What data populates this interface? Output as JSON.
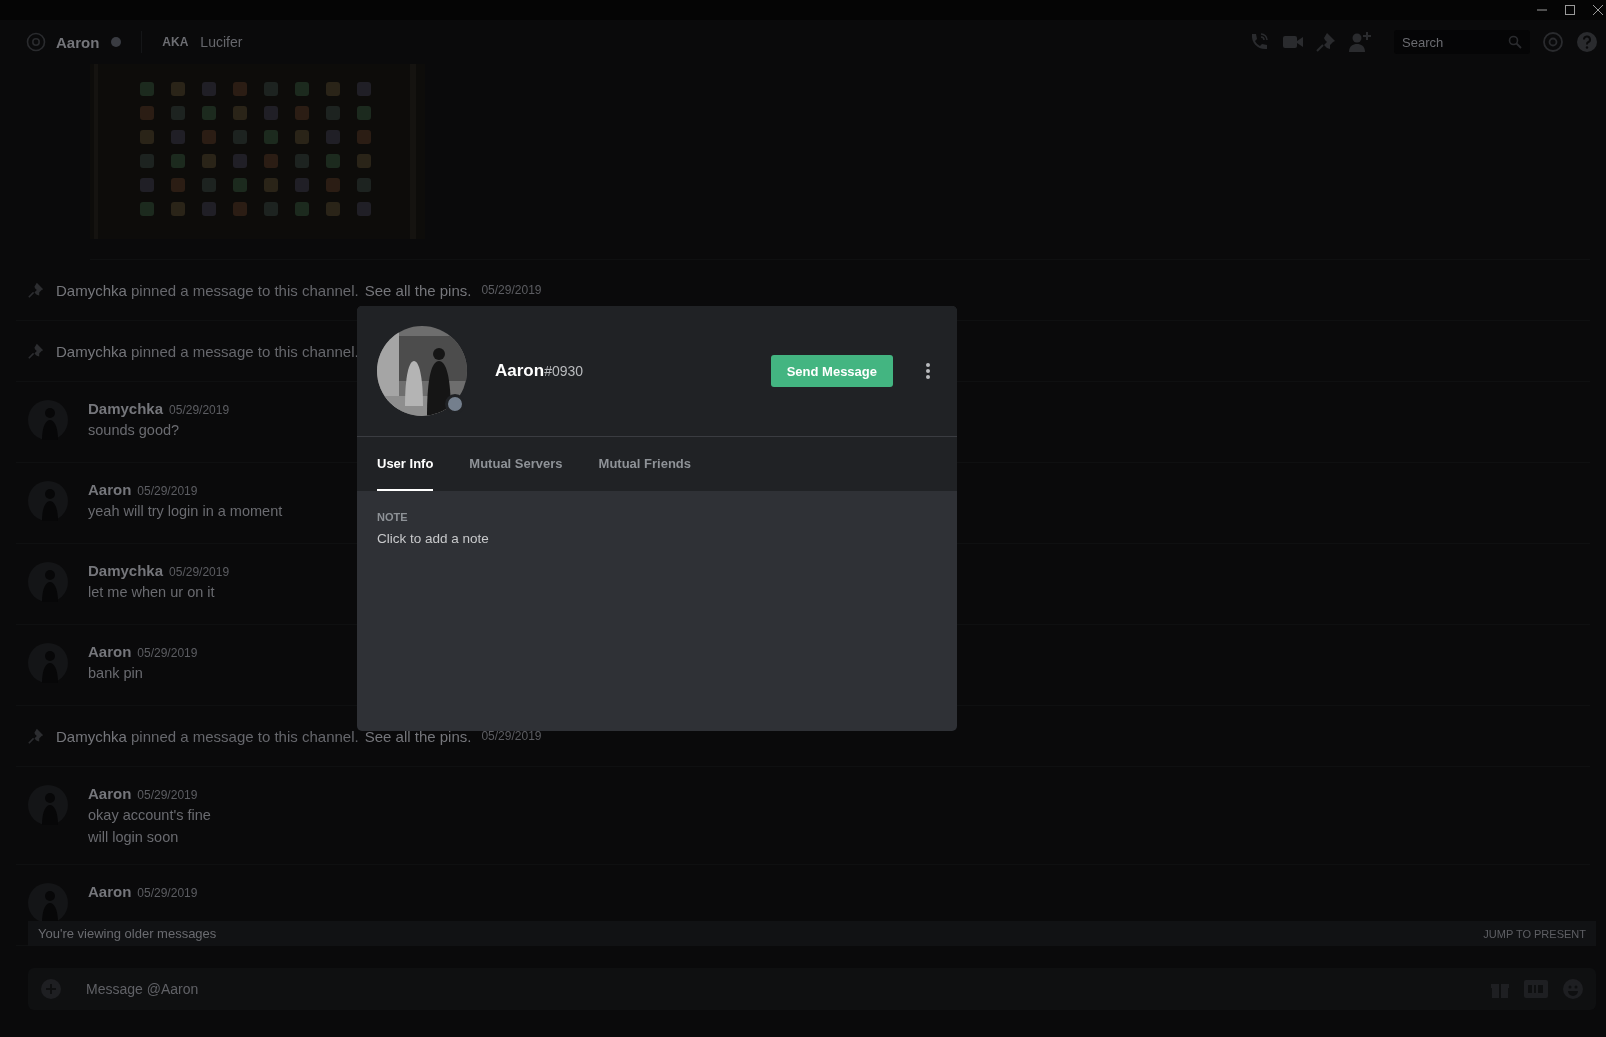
{
  "header": {
    "name": "Aaron",
    "online": false,
    "aka_label": "AKA",
    "aka": "Lucifer",
    "search": {
      "placeholder": "Search"
    }
  },
  "messages": [
    {
      "kind": "attachment"
    },
    {
      "kind": "pin",
      "author": "Damychka",
      "text": "pinned a message to this channel.",
      "link": "See all the pins.",
      "time": "05/29/2019"
    },
    {
      "kind": "pin",
      "author": "Damychka",
      "text": "pinned a message to this channel."
    },
    {
      "kind": "message",
      "author": "Damychka",
      "time": "05/29/2019",
      "lines": [
        "sounds good?"
      ]
    },
    {
      "kind": "message",
      "author": "Aaron",
      "time": "05/29/2019",
      "lines": [
        "yeah will try login in a moment"
      ]
    },
    {
      "kind": "message",
      "author": "Damychka",
      "time": "05/29/2019",
      "lines": [
        "let me when ur on it"
      ]
    },
    {
      "kind": "message",
      "author": "Aaron",
      "time": "05/29/2019",
      "lines": [
        "bank pin"
      ]
    },
    {
      "kind": "pin",
      "author": "Damychka",
      "text": "pinned a message to this channel.",
      "link": "See all the pins.",
      "time": "05/29/2019"
    },
    {
      "kind": "message",
      "author": "Aaron",
      "time": "05/29/2019",
      "lines": [
        "okay account's fine",
        "will login soon"
      ]
    },
    {
      "kind": "message",
      "author": "Aaron",
      "time": "05/29/2019"
    }
  ],
  "older_bar": {
    "text": "You're viewing older messages",
    "action": "JUMP TO PRESENT"
  },
  "composer": {
    "placeholder": "Message @Aaron"
  },
  "profile": {
    "name": "Aaron",
    "tag": "#0930",
    "online": false,
    "button": "Send Message",
    "tabs": [
      {
        "label": "User Info",
        "selected": true
      },
      {
        "label": "Mutual Servers",
        "selected": false
      },
      {
        "label": "Mutual Friends",
        "selected": false
      }
    ],
    "note_label": "NOTE",
    "note_placeholder": "Click to add a note"
  }
}
